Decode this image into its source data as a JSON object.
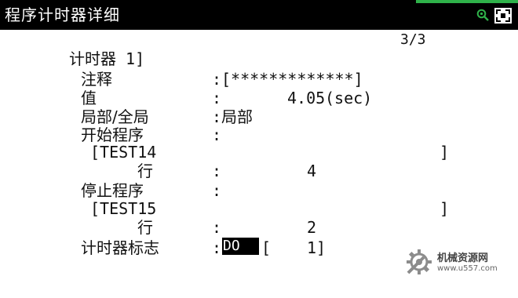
{
  "title_bar": {
    "title": "程序计时器详细"
  },
  "page_indicator": "3/3",
  "timer": {
    "heading": "计时器 1]",
    "comment": {
      "label": "注释",
      "colon": ":",
      "value": "[*************]"
    },
    "value": {
      "label": "值",
      "colon": ":",
      "number": "4.05",
      "unit": "(sec)"
    },
    "scope": {
      "label": "局部/全局",
      "colon": ":",
      "value": "局部"
    },
    "start_program": {
      "label": "开始程序",
      "colon": ":",
      "program_open": "[TEST14",
      "program_close": "]",
      "line_label": "行",
      "line_colon": ":",
      "line_value": "4"
    },
    "stop_program": {
      "label": "停止程序",
      "colon": ":",
      "program_open": "[TEST15",
      "program_close": "]",
      "line_label": "行",
      "line_colon": ":",
      "line_value": "2"
    },
    "flag": {
      "label": "计时器标志",
      "colon": ":",
      "value": "DO",
      "bracket_open": "[",
      "index": "1",
      "bracket_close": "]"
    }
  },
  "watermark": {
    "name": "机械资源网",
    "url": "www.u557.com"
  },
  "colors": {
    "title_bg": "#000000",
    "accent_green": "#2fb24a",
    "logo_gray": "#8c8c8c"
  }
}
